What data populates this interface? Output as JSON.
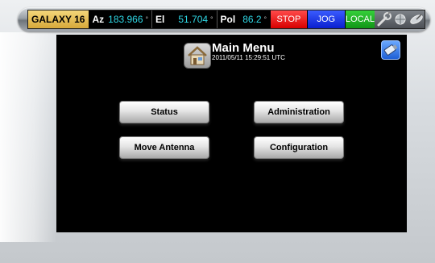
{
  "status_bar": {
    "satellite": "GALAXY 16",
    "az_label": "Az",
    "az_value": "183.966",
    "el_label": "El",
    "el_value": "51.704",
    "pol_label": "Pol",
    "pol_value": "86.2",
    "degree": "°",
    "stop_label": "STOP",
    "jog_label": "JOG",
    "local_label": "LOCAL",
    "colors": {
      "stop": "#e60000",
      "jog": "#1230e0",
      "local": "#1aa520",
      "value": "#2fd8e6"
    }
  },
  "screen": {
    "title": "Main Menu",
    "datetime": "2011/05/11 15:29:51 UTC",
    "icons": [
      "home-icon",
      "usb-icon",
      "wrench-icon",
      "network-icon",
      "satellite-dish-icon"
    ]
  },
  "menu": {
    "status": "Status",
    "administration": "Administration",
    "move_antenna": "Move Antenna",
    "configuration": "Configuration"
  }
}
